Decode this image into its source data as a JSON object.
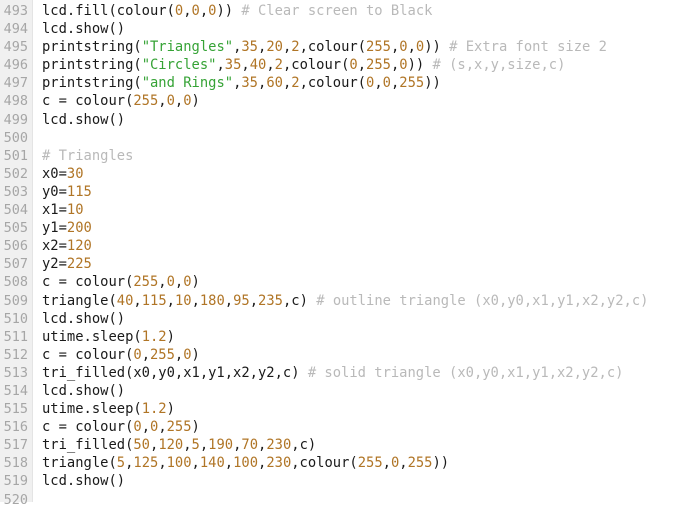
{
  "editor": {
    "name": "code-editor",
    "language": "python",
    "first_line_number": 493,
    "last_line_number": 520,
    "colors": {
      "background": "#ffffff",
      "gutter_background": "#f0f0f0",
      "gutter_text": "#a6a6a6",
      "gutter_border": "#e4e4e4",
      "text": "#1a1a1a",
      "number_literal": "#b07526",
      "string_literal": "#36a336",
      "comment": "#b9b9b9"
    },
    "lines": [
      {
        "number": "493",
        "text": "lcd.fill(colour(0,0,0)) # Clear screen to Black",
        "tokens": [
          {
            "t": "lcd.fill(colour(",
            "c": "plain"
          },
          {
            "t": "0",
            "c": "num"
          },
          {
            "t": ",",
            "c": "plain"
          },
          {
            "t": "0",
            "c": "num"
          },
          {
            "t": ",",
            "c": "plain"
          },
          {
            "t": "0",
            "c": "num"
          },
          {
            "t": ")) ",
            "c": "plain"
          },
          {
            "t": "# Clear screen to Black",
            "c": "comment"
          }
        ]
      },
      {
        "number": "494",
        "text": "lcd.show()",
        "tokens": [
          {
            "t": "lcd.show()",
            "c": "plain"
          }
        ]
      },
      {
        "number": "495",
        "text": "printstring(\"Triangles\",35,20,2,colour(255,0,0)) # Extra font size 2",
        "tokens": [
          {
            "t": "printstring(",
            "c": "plain"
          },
          {
            "t": "\"Triangles\"",
            "c": "str"
          },
          {
            "t": ",",
            "c": "plain"
          },
          {
            "t": "35",
            "c": "num"
          },
          {
            "t": ",",
            "c": "plain"
          },
          {
            "t": "20",
            "c": "num"
          },
          {
            "t": ",",
            "c": "plain"
          },
          {
            "t": "2",
            "c": "num"
          },
          {
            "t": ",colour(",
            "c": "plain"
          },
          {
            "t": "255",
            "c": "num"
          },
          {
            "t": ",",
            "c": "plain"
          },
          {
            "t": "0",
            "c": "num"
          },
          {
            "t": ",",
            "c": "plain"
          },
          {
            "t": "0",
            "c": "num"
          },
          {
            "t": ")) ",
            "c": "plain"
          },
          {
            "t": "# Extra font size 2",
            "c": "comment"
          }
        ]
      },
      {
        "number": "496",
        "text": "printstring(\"Circles\",35,40,2,colour(0,255,0)) # (s,x,y,size,c)",
        "tokens": [
          {
            "t": "printstring(",
            "c": "plain"
          },
          {
            "t": "\"Circles\"",
            "c": "str"
          },
          {
            "t": ",",
            "c": "plain"
          },
          {
            "t": "35",
            "c": "num"
          },
          {
            "t": ",",
            "c": "plain"
          },
          {
            "t": "40",
            "c": "num"
          },
          {
            "t": ",",
            "c": "plain"
          },
          {
            "t": "2",
            "c": "num"
          },
          {
            "t": ",colour(",
            "c": "plain"
          },
          {
            "t": "0",
            "c": "num"
          },
          {
            "t": ",",
            "c": "plain"
          },
          {
            "t": "255",
            "c": "num"
          },
          {
            "t": ",",
            "c": "plain"
          },
          {
            "t": "0",
            "c": "num"
          },
          {
            "t": ")) ",
            "c": "plain"
          },
          {
            "t": "# (s,x,y,size,c)",
            "c": "comment"
          }
        ]
      },
      {
        "number": "497",
        "text": "printstring(\"and Rings\",35,60,2,colour(0,0,255))",
        "tokens": [
          {
            "t": "printstring(",
            "c": "plain"
          },
          {
            "t": "\"and Rings\"",
            "c": "str"
          },
          {
            "t": ",",
            "c": "plain"
          },
          {
            "t": "35",
            "c": "num"
          },
          {
            "t": ",",
            "c": "plain"
          },
          {
            "t": "60",
            "c": "num"
          },
          {
            "t": ",",
            "c": "plain"
          },
          {
            "t": "2",
            "c": "num"
          },
          {
            "t": ",colour(",
            "c": "plain"
          },
          {
            "t": "0",
            "c": "num"
          },
          {
            "t": ",",
            "c": "plain"
          },
          {
            "t": "0",
            "c": "num"
          },
          {
            "t": ",",
            "c": "plain"
          },
          {
            "t": "255",
            "c": "num"
          },
          {
            "t": "))",
            "c": "plain"
          }
        ]
      },
      {
        "number": "498",
        "text": "c = colour(255,0,0)",
        "tokens": [
          {
            "t": "c = colour(",
            "c": "plain"
          },
          {
            "t": "255",
            "c": "num"
          },
          {
            "t": ",",
            "c": "plain"
          },
          {
            "t": "0",
            "c": "num"
          },
          {
            "t": ",",
            "c": "plain"
          },
          {
            "t": "0",
            "c": "num"
          },
          {
            "t": ")",
            "c": "plain"
          }
        ]
      },
      {
        "number": "499",
        "text": "lcd.show()",
        "tokens": [
          {
            "t": "lcd.show()",
            "c": "plain"
          }
        ]
      },
      {
        "number": "500",
        "text": "",
        "tokens": []
      },
      {
        "number": "501",
        "text": "# Triangles",
        "tokens": [
          {
            "t": "# Triangles",
            "c": "comment"
          }
        ]
      },
      {
        "number": "502",
        "text": "x0=30",
        "tokens": [
          {
            "t": "x0=",
            "c": "plain"
          },
          {
            "t": "30",
            "c": "num"
          }
        ]
      },
      {
        "number": "503",
        "text": "y0=115",
        "tokens": [
          {
            "t": "y0=",
            "c": "plain"
          },
          {
            "t": "115",
            "c": "num"
          }
        ]
      },
      {
        "number": "504",
        "text": "x1=10",
        "tokens": [
          {
            "t": "x1=",
            "c": "plain"
          },
          {
            "t": "10",
            "c": "num"
          }
        ]
      },
      {
        "number": "505",
        "text": "y1=200",
        "tokens": [
          {
            "t": "y1=",
            "c": "plain"
          },
          {
            "t": "200",
            "c": "num"
          }
        ]
      },
      {
        "number": "506",
        "text": "x2=120",
        "tokens": [
          {
            "t": "x2=",
            "c": "plain"
          },
          {
            "t": "120",
            "c": "num"
          }
        ]
      },
      {
        "number": "507",
        "text": "y2=225",
        "tokens": [
          {
            "t": "y2=",
            "c": "plain"
          },
          {
            "t": "225",
            "c": "num"
          }
        ]
      },
      {
        "number": "508",
        "text": "c = colour(255,0,0)",
        "tokens": [
          {
            "t": "c = colour(",
            "c": "plain"
          },
          {
            "t": "255",
            "c": "num"
          },
          {
            "t": ",",
            "c": "plain"
          },
          {
            "t": "0",
            "c": "num"
          },
          {
            "t": ",",
            "c": "plain"
          },
          {
            "t": "0",
            "c": "num"
          },
          {
            "t": ")",
            "c": "plain"
          }
        ]
      },
      {
        "number": "509",
        "text": "triangle(40,115,10,180,95,235,c) # outline triangle (x0,y0,x1,y1,x2,y2,c)",
        "tokens": [
          {
            "t": "triangle(",
            "c": "plain"
          },
          {
            "t": "40",
            "c": "num"
          },
          {
            "t": ",",
            "c": "plain"
          },
          {
            "t": "115",
            "c": "num"
          },
          {
            "t": ",",
            "c": "plain"
          },
          {
            "t": "10",
            "c": "num"
          },
          {
            "t": ",",
            "c": "plain"
          },
          {
            "t": "180",
            "c": "num"
          },
          {
            "t": ",",
            "c": "plain"
          },
          {
            "t": "95",
            "c": "num"
          },
          {
            "t": ",",
            "c": "plain"
          },
          {
            "t": "235",
            "c": "num"
          },
          {
            "t": ",c) ",
            "c": "plain"
          },
          {
            "t": "# outline triangle (x0,y0,x1,y1,x2,y2,c)",
            "c": "comment"
          }
        ]
      },
      {
        "number": "510",
        "text": "lcd.show()",
        "tokens": [
          {
            "t": "lcd.show()",
            "c": "plain"
          }
        ]
      },
      {
        "number": "511",
        "text": "utime.sleep(1.2)",
        "tokens": [
          {
            "t": "utime.sleep(",
            "c": "plain"
          },
          {
            "t": "1.2",
            "c": "num"
          },
          {
            "t": ")",
            "c": "plain"
          }
        ]
      },
      {
        "number": "512",
        "text": "c = colour(0,255,0)",
        "tokens": [
          {
            "t": "c = colour(",
            "c": "plain"
          },
          {
            "t": "0",
            "c": "num"
          },
          {
            "t": ",",
            "c": "plain"
          },
          {
            "t": "255",
            "c": "num"
          },
          {
            "t": ",",
            "c": "plain"
          },
          {
            "t": "0",
            "c": "num"
          },
          {
            "t": ")",
            "c": "plain"
          }
        ]
      },
      {
        "number": "513",
        "text": "tri_filled(x0,y0,x1,y1,x2,y2,c) # solid triangle (x0,y0,x1,y1,x2,y2,c)",
        "tokens": [
          {
            "t": "tri_filled(x0,y0,x1,y1,x2,y2,c) ",
            "c": "plain"
          },
          {
            "t": "# solid triangle (x0,y0,x1,y1,x2,y2,c)",
            "c": "comment"
          }
        ]
      },
      {
        "number": "514",
        "text": "lcd.show()",
        "tokens": [
          {
            "t": "lcd.show()",
            "c": "plain"
          }
        ]
      },
      {
        "number": "515",
        "text": "utime.sleep(1.2)",
        "tokens": [
          {
            "t": "utime.sleep(",
            "c": "plain"
          },
          {
            "t": "1.2",
            "c": "num"
          },
          {
            "t": ")",
            "c": "plain"
          }
        ]
      },
      {
        "number": "516",
        "text": "c = colour(0,0,255)",
        "tokens": [
          {
            "t": "c = colour(",
            "c": "plain"
          },
          {
            "t": "0",
            "c": "num"
          },
          {
            "t": ",",
            "c": "plain"
          },
          {
            "t": "0",
            "c": "num"
          },
          {
            "t": ",",
            "c": "plain"
          },
          {
            "t": "255",
            "c": "num"
          },
          {
            "t": ")",
            "c": "plain"
          }
        ]
      },
      {
        "number": "517",
        "text": "tri_filled(50,120,5,190,70,230,c)",
        "tokens": [
          {
            "t": "tri_filled(",
            "c": "plain"
          },
          {
            "t": "50",
            "c": "num"
          },
          {
            "t": ",",
            "c": "plain"
          },
          {
            "t": "120",
            "c": "num"
          },
          {
            "t": ",",
            "c": "plain"
          },
          {
            "t": "5",
            "c": "num"
          },
          {
            "t": ",",
            "c": "plain"
          },
          {
            "t": "190",
            "c": "num"
          },
          {
            "t": ",",
            "c": "plain"
          },
          {
            "t": "70",
            "c": "num"
          },
          {
            "t": ",",
            "c": "plain"
          },
          {
            "t": "230",
            "c": "num"
          },
          {
            "t": ",c)",
            "c": "plain"
          }
        ]
      },
      {
        "number": "518",
        "text": "triangle(5,125,100,140,100,230,colour(255,0,255))",
        "tokens": [
          {
            "t": "triangle(",
            "c": "plain"
          },
          {
            "t": "5",
            "c": "num"
          },
          {
            "t": ",",
            "c": "plain"
          },
          {
            "t": "125",
            "c": "num"
          },
          {
            "t": ",",
            "c": "plain"
          },
          {
            "t": "100",
            "c": "num"
          },
          {
            "t": ",",
            "c": "plain"
          },
          {
            "t": "140",
            "c": "num"
          },
          {
            "t": ",",
            "c": "plain"
          },
          {
            "t": "100",
            "c": "num"
          },
          {
            "t": ",",
            "c": "plain"
          },
          {
            "t": "230",
            "c": "num"
          },
          {
            "t": ",colour(",
            "c": "plain"
          },
          {
            "t": "255",
            "c": "num"
          },
          {
            "t": ",",
            "c": "plain"
          },
          {
            "t": "0",
            "c": "num"
          },
          {
            "t": ",",
            "c": "plain"
          },
          {
            "t": "255",
            "c": "num"
          },
          {
            "t": "))",
            "c": "plain"
          }
        ]
      },
      {
        "number": "519",
        "text": "lcd.show()",
        "tokens": [
          {
            "t": "lcd.show()",
            "c": "plain"
          }
        ]
      },
      {
        "number": "520",
        "text": "",
        "tokens": []
      }
    ]
  }
}
